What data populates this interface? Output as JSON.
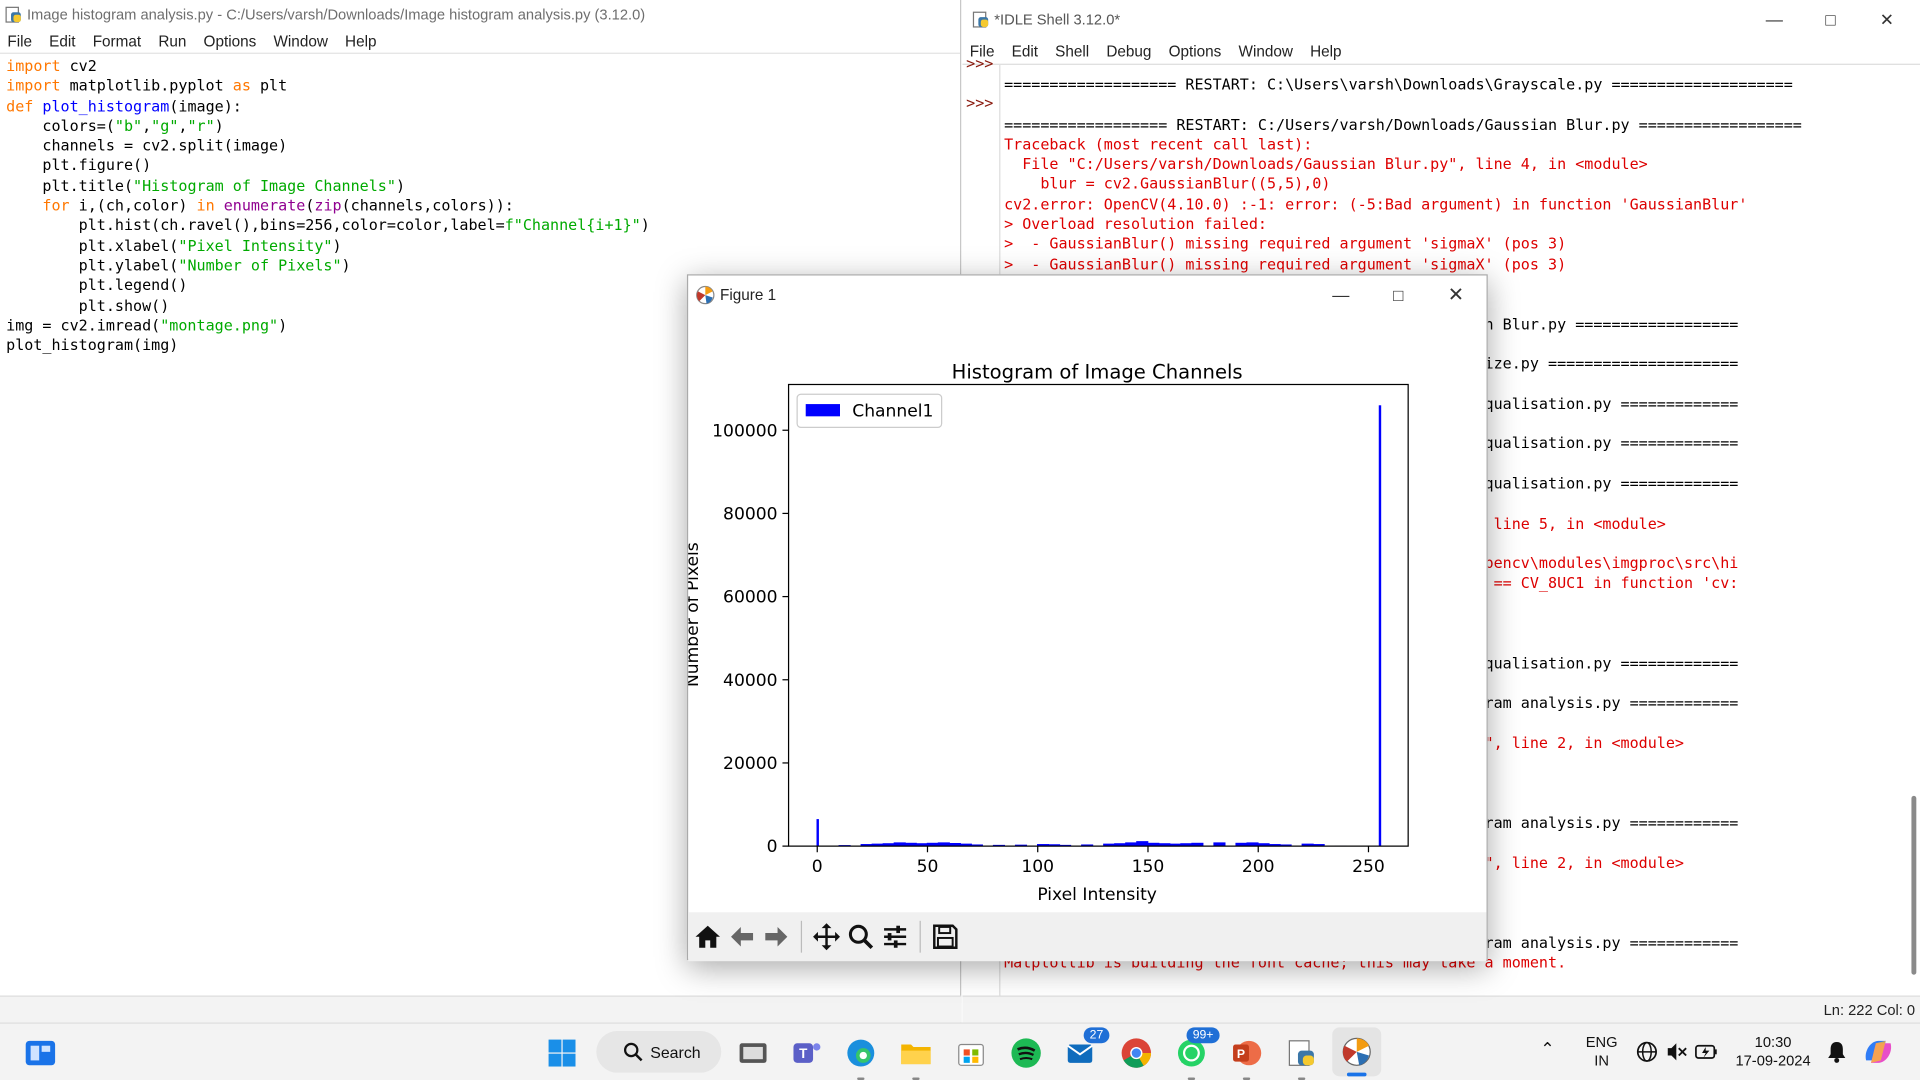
{
  "editor": {
    "title": "Image histogram analysis.py - C:/Users/varsh/Downloads/Image histogram analysis.py (3.12.0)",
    "menu": [
      "File",
      "Edit",
      "Format",
      "Run",
      "Options",
      "Window",
      "Help"
    ]
  },
  "shell": {
    "title": "*IDLE Shell 3.12.0*",
    "menu": [
      "File",
      "Edit",
      "Shell",
      "Debug",
      "Options",
      "Window",
      "Help"
    ],
    "prompt": ">>>",
    "status": "Ln: 222   Col: 0"
  },
  "figure": {
    "title": "Figure 1"
  },
  "chart_data": {
    "type": "bar",
    "title": "Histogram of Image Channels",
    "xlabel": "Pixel Intensity",
    "ylabel": "Number of Pixels",
    "xlim": [
      -13,
      268
    ],
    "ylim": [
      0,
      111000
    ],
    "xticks": [
      0,
      50,
      100,
      150,
      200,
      250
    ],
    "yticks": [
      0,
      20000,
      40000,
      60000,
      80000,
      100000
    ],
    "legend": "top-left",
    "grid": false,
    "series": [
      {
        "name": "Channel1",
        "color": "#0000ff",
        "points": [
          [
            0,
            6500
          ],
          [
            10,
            250
          ],
          [
            20,
            500
          ],
          [
            25,
            600
          ],
          [
            30,
            700
          ],
          [
            35,
            900
          ],
          [
            40,
            800
          ],
          [
            45,
            700
          ],
          [
            50,
            800
          ],
          [
            55,
            900
          ],
          [
            60,
            750
          ],
          [
            65,
            600
          ],
          [
            70,
            400
          ],
          [
            80,
            300
          ],
          [
            90,
            350
          ],
          [
            100,
            500
          ],
          [
            105,
            450
          ],
          [
            110,
            300
          ],
          [
            120,
            400
          ],
          [
            130,
            600
          ],
          [
            135,
            700
          ],
          [
            140,
            900
          ],
          [
            145,
            1200
          ],
          [
            150,
            800
          ],
          [
            155,
            700
          ],
          [
            160,
            600
          ],
          [
            165,
            700
          ],
          [
            170,
            800
          ],
          [
            180,
            900
          ],
          [
            190,
            800
          ],
          [
            195,
            900
          ],
          [
            200,
            700
          ],
          [
            205,
            500
          ],
          [
            210,
            400
          ],
          [
            220,
            600
          ],
          [
            225,
            500
          ],
          [
            235,
            150
          ],
          [
            255,
            106000
          ]
        ]
      }
    ]
  },
  "taskbar": {
    "search": "Search",
    "teams_badge": "27",
    "whatsapp_badge": "99+",
    "lang_top": "ENG",
    "lang_bottom": "IN",
    "time": "10:30",
    "date": "17-09-2024"
  }
}
